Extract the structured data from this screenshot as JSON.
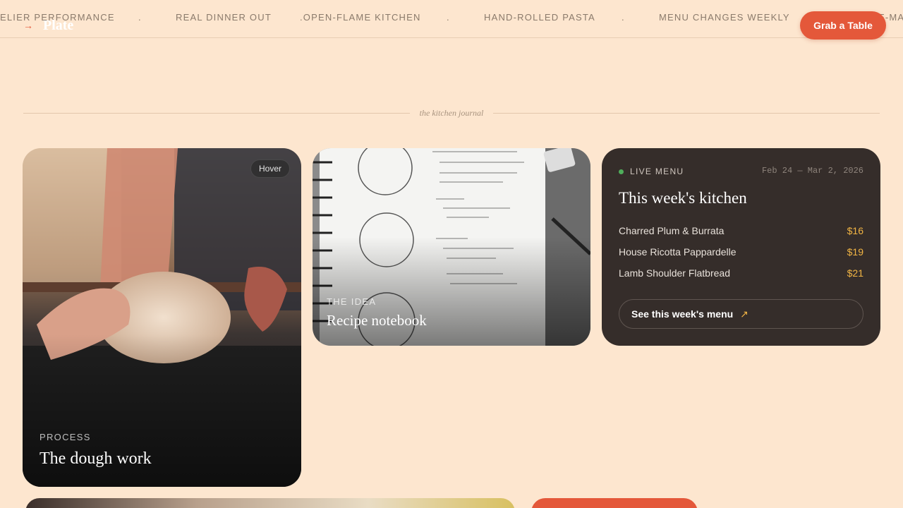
{
  "marquee": {
    "items": [
      "ELIER PERFORMANCE",
      ".",
      "REAL DINNER OUT",
      ".OPEN-FLAME KITCHEN",
      ".",
      "HAND-ROLLED PASTA",
      ".",
      "MENU CHANGES WEEKLY",
      "E-MA"
    ]
  },
  "header": {
    "logo_text": "Plate",
    "logo_arrow": "→",
    "cta_label": "Grab a Table"
  },
  "section": {
    "label": "the kitchen journal"
  },
  "cards": {
    "dough": {
      "eyebrow": "PROCESS",
      "title": "The dough work",
      "badge": "Hover"
    },
    "notebook": {
      "eyebrow": "THE IDEA",
      "title": "Recipe notebook"
    }
  },
  "menu": {
    "live_label": "LIVE MENU",
    "dates": "Feb 24 — Mar 2, 2026",
    "title": "This week's kitchen",
    "items": [
      {
        "name": "Charred Plum & Burrata",
        "price": "$16"
      },
      {
        "name": "House Ricotta Pappardelle",
        "price": "$19"
      },
      {
        "name": "Lamb Shoulder Flatbread",
        "price": "$21"
      }
    ],
    "button_label": "See this week's menu",
    "button_icon": "↗"
  },
  "colors": {
    "background": "#fde6cf",
    "accent": "#e4583a",
    "price": "#f2b544",
    "live_dot": "#4fae5b",
    "menu_card": "#352d2a"
  }
}
